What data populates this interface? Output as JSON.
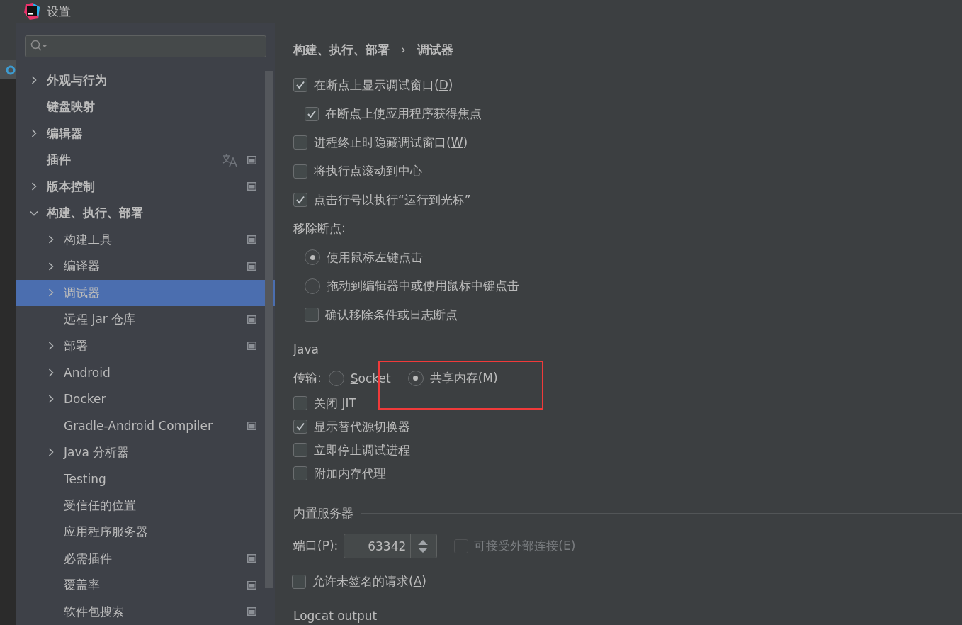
{
  "window": {
    "title": "设置"
  },
  "sidebar": {
    "tree": [
      {
        "label": "外观与行为",
        "kind": "folder",
        "expanded": false,
        "selected": false,
        "translation": false,
        "project_settings": false
      },
      {
        "label": "键盘映射",
        "kind": "page",
        "selected": false,
        "translation": false,
        "project_settings": false
      },
      {
        "label": "编辑器",
        "kind": "folder",
        "expanded": false,
        "selected": false,
        "translation": false,
        "project_settings": false
      },
      {
        "label": "插件",
        "kind": "page",
        "selected": false,
        "translation": true,
        "project_settings": true
      },
      {
        "label": "版本控制",
        "kind": "folder",
        "expanded": false,
        "selected": false,
        "translation": false,
        "project_settings": true
      },
      {
        "label": "构建、执行、部署",
        "kind": "folder",
        "expanded": true,
        "selected": false,
        "translation": false,
        "project_settings": false,
        "children": [
          {
            "label": "构建工具",
            "kind": "folder",
            "expanded": false,
            "selected": false,
            "translation": false,
            "project_settings": true
          },
          {
            "label": "编译器",
            "kind": "folder",
            "expanded": false,
            "selected": false,
            "translation": false,
            "project_settings": true
          },
          {
            "label": "调试器",
            "kind": "folder",
            "expanded": false,
            "selected": true,
            "translation": false,
            "project_settings": false
          },
          {
            "label": "远程 Jar 仓库",
            "kind": "page",
            "selected": false,
            "translation": false,
            "project_settings": true
          },
          {
            "label": "部署",
            "kind": "folder",
            "expanded": false,
            "selected": false,
            "translation": false,
            "project_settings": true
          },
          {
            "label": "Android",
            "kind": "folder",
            "expanded": false,
            "selected": false,
            "translation": false,
            "project_settings": false
          },
          {
            "label": "Docker",
            "kind": "folder",
            "expanded": false,
            "selected": false,
            "translation": false,
            "project_settings": false
          },
          {
            "label": "Gradle-Android Compiler",
            "kind": "page",
            "selected": false,
            "translation": false,
            "project_settings": true
          },
          {
            "label": "Java 分析器",
            "kind": "folder",
            "expanded": false,
            "selected": false,
            "translation": false,
            "project_settings": false
          },
          {
            "label": "Testing",
            "kind": "page",
            "selected": false,
            "translation": false,
            "project_settings": false
          },
          {
            "label": "受信任的位置",
            "kind": "page",
            "selected": false,
            "translation": false,
            "project_settings": false
          },
          {
            "label": "应用程序服务器",
            "kind": "page",
            "selected": false,
            "translation": false,
            "project_settings": false
          },
          {
            "label": "必需插件",
            "kind": "page",
            "selected": false,
            "translation": false,
            "project_settings": true
          },
          {
            "label": "覆盖率",
            "kind": "page",
            "selected": false,
            "translation": false,
            "project_settings": true
          },
          {
            "label": "软件包搜索",
            "kind": "page",
            "selected": false,
            "translation": false,
            "project_settings": true
          }
        ]
      }
    ]
  },
  "breadcrumb": {
    "path": "构建、执行、部署",
    "separator": "›",
    "current": "调试器"
  },
  "general": [
    {
      "kind": "checkbox",
      "label": {
        "text": "在断点上显示调试窗口(",
        "mnemonic": "D",
        "after": ")"
      },
      "checked": true,
      "children": [
        {
          "kind": "checkbox",
          "label": {
            "text": "在断点上使应用程序获得焦点"
          },
          "checked": true
        }
      ]
    },
    {
      "kind": "checkbox",
      "label": {
        "text": "进程终止时隐藏调试窗口(",
        "mnemonic": "W",
        "after": ")"
      },
      "checked": false
    },
    {
      "kind": "checkbox",
      "label": {
        "text": "将执行点滚动到中心"
      },
      "checked": false
    },
    {
      "kind": "checkbox",
      "label": {
        "text": "点击行号以执行“运行到光标”"
      },
      "checked": true
    },
    {
      "kind": "group",
      "label": {
        "text": "移除断点:"
      },
      "children": [
        {
          "kind": "radio",
          "label": {
            "text": "使用鼠标左键点击"
          },
          "selected": true
        },
        {
          "kind": "radio",
          "label": {
            "text": "拖动到编辑器中或使用鼠标中键点击"
          },
          "selected": false
        },
        {
          "kind": "checkbox",
          "label": {
            "text": "确认移除条件或日志断点"
          },
          "checked": false
        }
      ]
    }
  ],
  "java": {
    "title": "Java",
    "transport": {
      "label": "传输:",
      "options": [
        {
          "label": {
            "mnemonic": "S",
            "after": "ocket"
          },
          "selected": false
        },
        {
          "label": {
            "text": "共享内存(",
            "mnemonic": "M",
            "after": ")"
          },
          "selected": true
        }
      ]
    },
    "options": [
      {
        "kind": "checkbox",
        "label": {
          "text": "关闭 JIT"
        },
        "checked": false
      },
      {
        "kind": "checkbox",
        "label": {
          "text": "显示替代源切换器"
        },
        "checked": true
      },
      {
        "kind": "checkbox",
        "label": {
          "text": "立即停止调试进程"
        },
        "checked": false
      },
      {
        "kind": "checkbox",
        "label": {
          "text": "附加内存代理"
        },
        "checked": false
      }
    ]
  },
  "server": {
    "title": "内置服务器",
    "port": {
      "label": {
        "text": "端口(",
        "mnemonic": "P",
        "after": "):"
      },
      "value": "63342"
    },
    "external": {
      "label": {
        "text": "可接受外部连接(",
        "mnemonic": "E",
        "after": ")"
      },
      "checked": false,
      "disabled": true
    },
    "options": [
      {
        "kind": "checkbox",
        "label": {
          "text": "允许未签名的请求(",
          "mnemonic": "A",
          "after": ")"
        },
        "checked": false
      }
    ]
  },
  "logcat": {
    "title": "Logcat output"
  }
}
